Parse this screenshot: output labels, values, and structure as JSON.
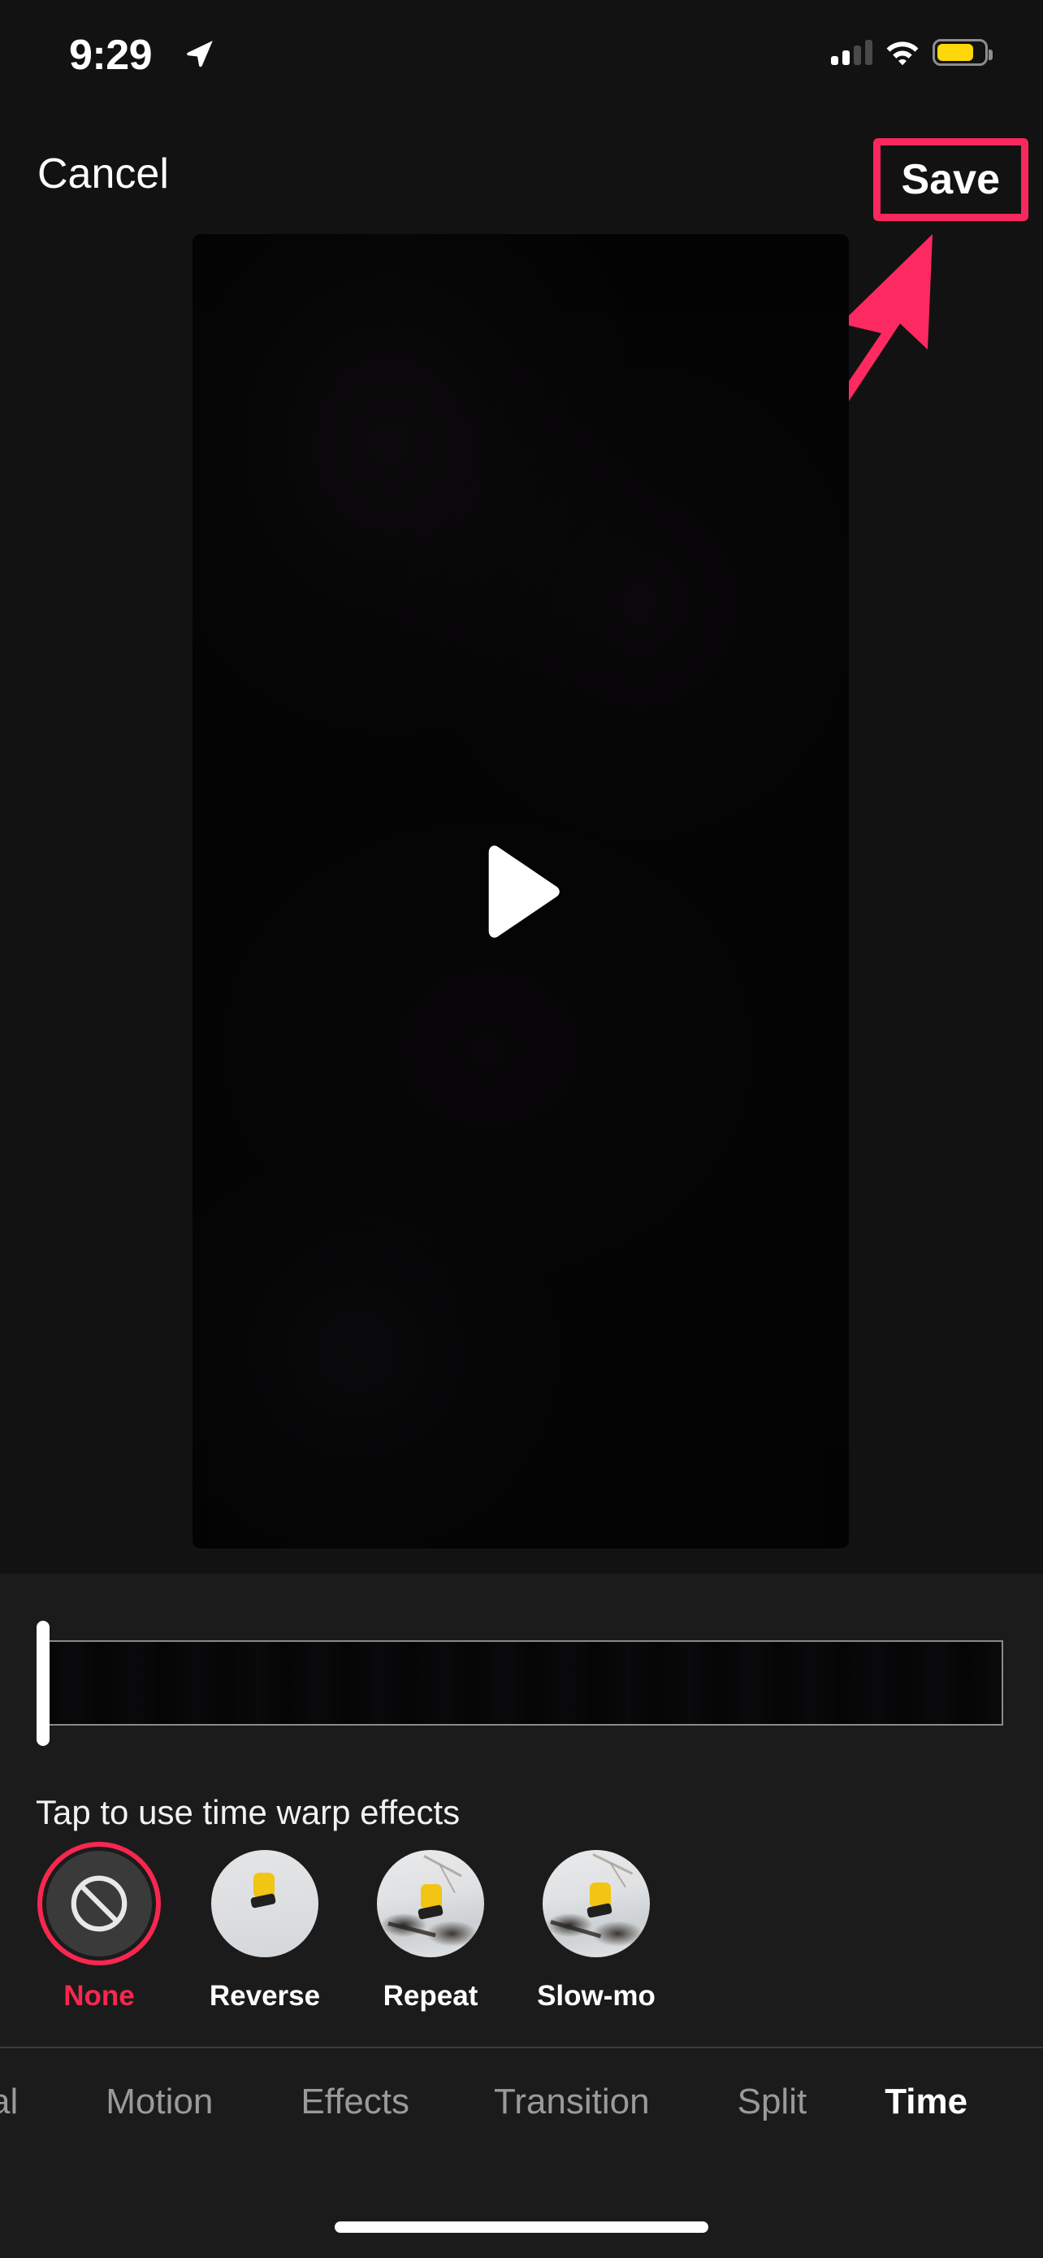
{
  "status_bar": {
    "time": "9:29",
    "location_icon": "location-arrow-icon",
    "cellular_icon": "cellular-signal-icon",
    "cellular_bars_filled": 2,
    "cellular_bars_total": 4,
    "wifi_icon": "wifi-icon",
    "battery_icon": "battery-icon",
    "battery_color": "#FFD60A",
    "battery_level_percent": 78
  },
  "top_nav": {
    "cancel_label": "Cancel",
    "save_label": "Save",
    "save_highlight_color": "#F8285F"
  },
  "annotation": {
    "type": "arrow",
    "color": "#FC2A60",
    "points_to": "save-button"
  },
  "video_preview": {
    "play_icon": "play-icon",
    "state": "paused"
  },
  "timeline": {
    "playhead_icon": "playhead-handle",
    "hint_text": "Tap to use time warp effects"
  },
  "effects": {
    "selected_index": 0,
    "accent_color": "#F8274F",
    "items": [
      {
        "label": "None",
        "icon": "no-entry-icon",
        "selected": true
      },
      {
        "label": "Reverse",
        "icon": "thumbnail-reverse",
        "selected": false
      },
      {
        "label": "Repeat",
        "icon": "thumbnail-repeat",
        "selected": false
      },
      {
        "label": "Slow-mo",
        "icon": "thumbnail-slow-mo",
        "selected": false
      }
    ]
  },
  "tab_bar": {
    "active_label": "Time",
    "items": [
      {
        "label": "al",
        "active": false
      },
      {
        "label": "Motion",
        "active": false
      },
      {
        "label": "Effects",
        "active": false
      },
      {
        "label": "Transition",
        "active": false
      },
      {
        "label": "Split",
        "active": false
      },
      {
        "label": "Time",
        "active": true
      }
    ]
  },
  "home_indicator": {
    "present": true
  }
}
